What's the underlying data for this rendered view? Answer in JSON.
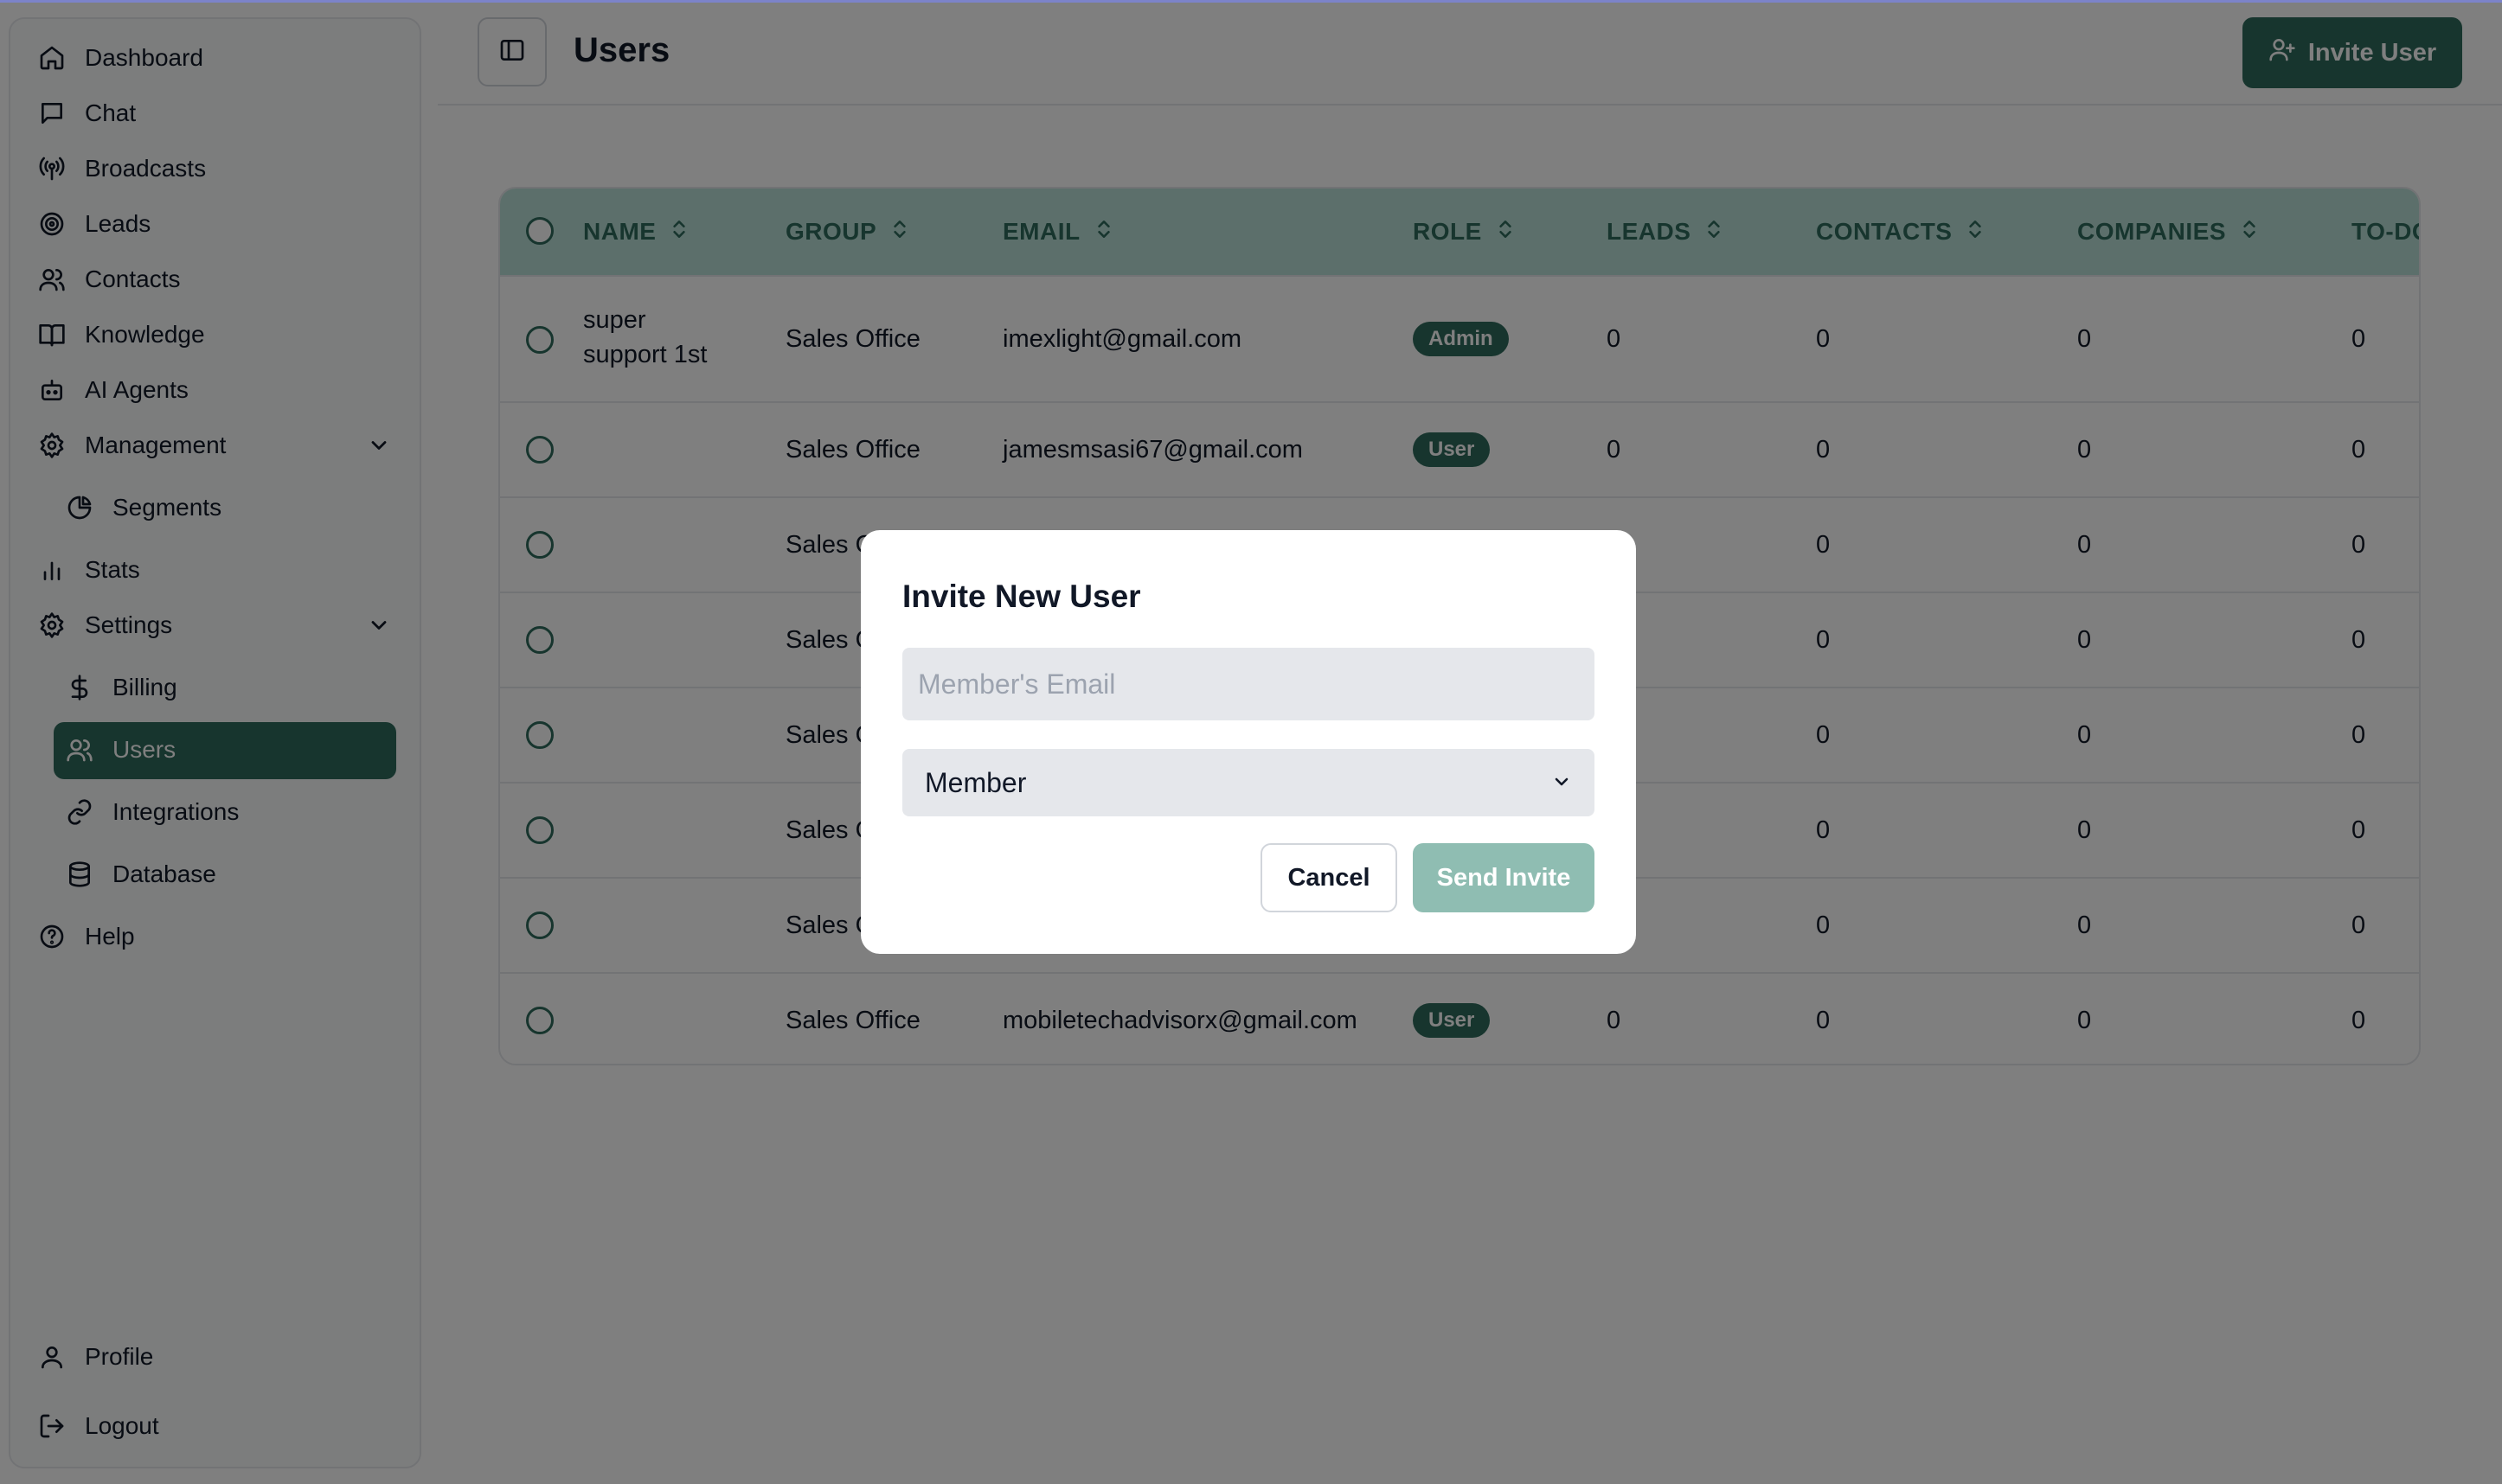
{
  "sidebar": {
    "items": [
      {
        "label": "Dashboard",
        "icon": "home-icon"
      },
      {
        "label": "Chat",
        "icon": "chat-icon"
      },
      {
        "label": "Broadcasts",
        "icon": "broadcast-icon"
      },
      {
        "label": "Leads",
        "icon": "target-icon"
      },
      {
        "label": "Contacts",
        "icon": "contacts-icon"
      },
      {
        "label": "Knowledge",
        "icon": "book-icon"
      },
      {
        "label": "AI Agents",
        "icon": "bot-icon"
      },
      {
        "label": "Management",
        "icon": "gear-icon"
      },
      {
        "label": "Segments",
        "icon": "pie-chart-icon"
      },
      {
        "label": "Stats",
        "icon": "bar-chart-icon"
      },
      {
        "label": "Settings",
        "icon": "gear-icon"
      },
      {
        "label": "Billing",
        "icon": "dollar-icon"
      },
      {
        "label": "Users",
        "icon": "users-icon"
      },
      {
        "label": "Integrations",
        "icon": "link-icon"
      },
      {
        "label": "Database",
        "icon": "database-icon"
      },
      {
        "label": "Help",
        "icon": "help-icon"
      }
    ],
    "profile": "Profile",
    "logout": "Logout"
  },
  "header": {
    "title": "Users",
    "invite_label": "Invite User"
  },
  "table": {
    "columns": [
      "NAME",
      "GROUP",
      "EMAIL",
      "ROLE",
      "LEADS",
      "CONTACTS",
      "COMPANIES",
      "TO-DO"
    ],
    "rows": [
      {
        "name_line1": "super",
        "name_line2": "support 1st",
        "group": "Sales Office",
        "email": "imexlight@gmail.com",
        "role": "Admin",
        "leads": "0",
        "contacts": "0",
        "companies": "0",
        "todo": "0"
      },
      {
        "name_line1": "",
        "name_line2": "",
        "group": "Sales Office",
        "email": "jamesmsasi67@gmail.com",
        "role": "User",
        "leads": "0",
        "contacts": "0",
        "companies": "0",
        "todo": "0"
      },
      {
        "group": "Sales O",
        "contacts": "0",
        "companies": "0",
        "todo": "0"
      },
      {
        "group": "Sales O",
        "contacts": "0",
        "companies": "0",
        "todo": "0"
      },
      {
        "group": "Sales O",
        "contacts": "0",
        "companies": "0",
        "todo": "0"
      },
      {
        "group": "Sales O",
        "contacts": "0",
        "companies": "0",
        "todo": "0"
      },
      {
        "group": "Sales O",
        "contacts": "0",
        "companies": "0",
        "todo": "0"
      },
      {
        "group": "Sales Office",
        "email": "mobiletechadvisorx@gmail.com",
        "role": "User",
        "leads": "0",
        "contacts": "0",
        "companies": "0",
        "todo": "0"
      }
    ]
  },
  "modal": {
    "title": "Invite New User",
    "email_placeholder": "Member's Email",
    "role_value": "Member",
    "cancel_label": "Cancel",
    "send_label": "Send Invite"
  },
  "colors": {
    "accent": "#2f6b5c",
    "header_bg": "#b9dfd6",
    "send_disabled": "#8fbdb2"
  }
}
